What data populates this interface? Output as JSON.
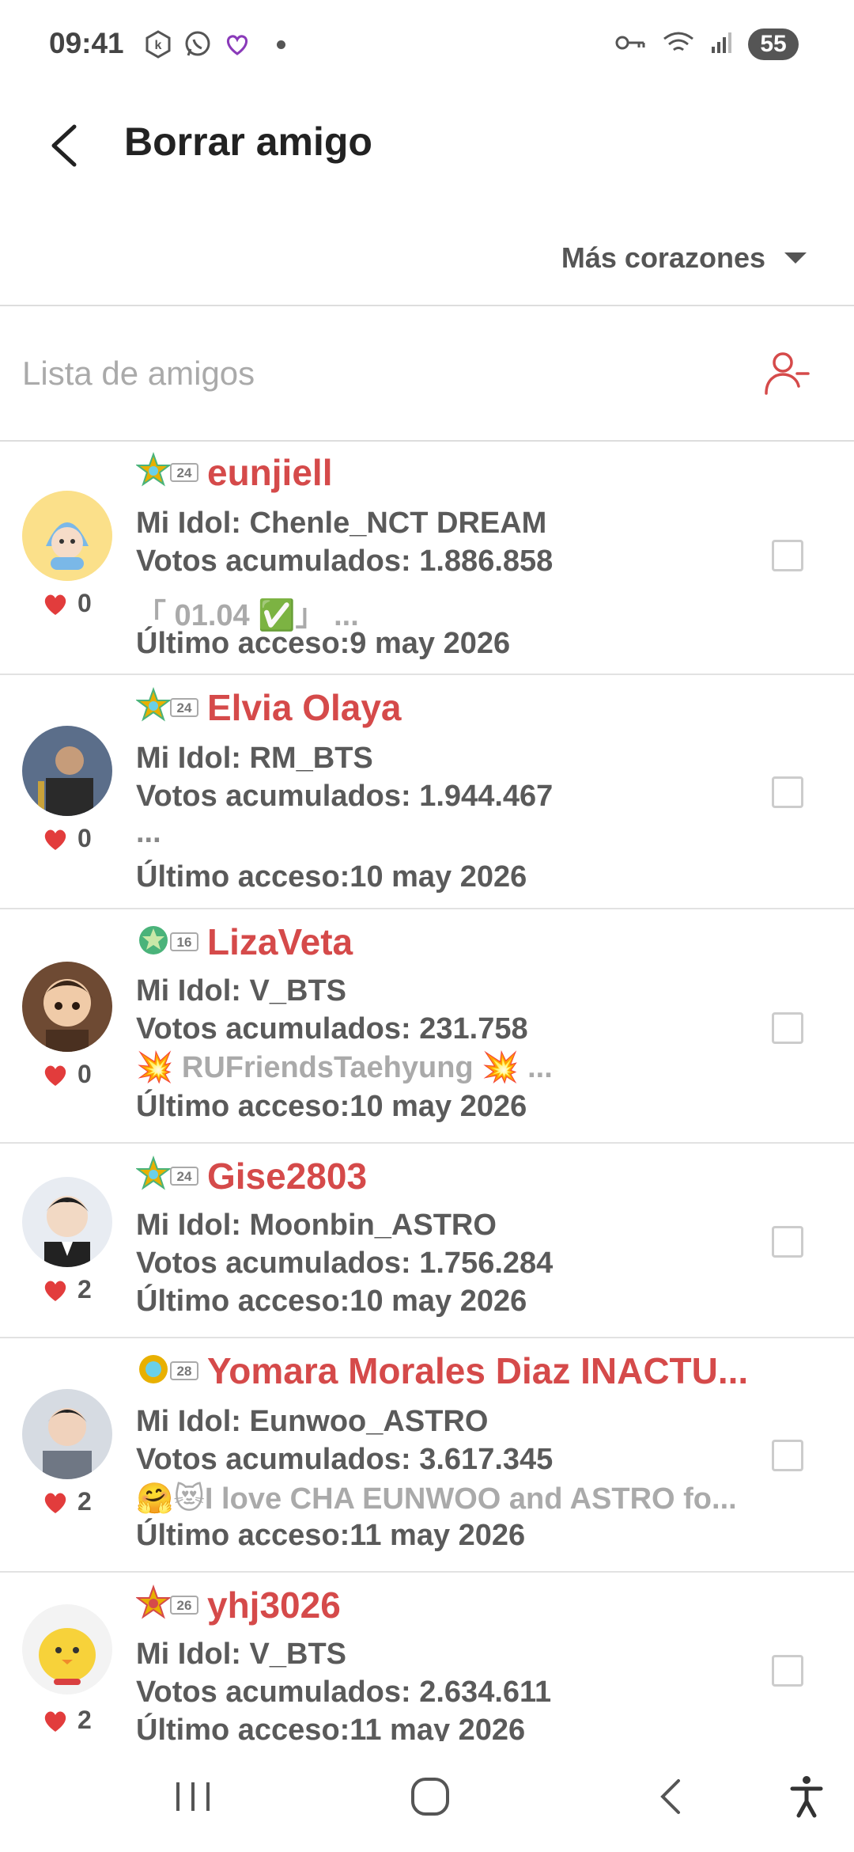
{
  "status_bar": {
    "time": "09:41",
    "battery": "55"
  },
  "header": {
    "title": "Borrar amigo"
  },
  "sort": {
    "label": "Más corazones"
  },
  "list": {
    "label": "Lista de amigos"
  },
  "colors": {
    "accent": "#d54a4a",
    "heart": "#e23c3c",
    "gold_badge": "#e8b000",
    "green_badge": "#4ab37a"
  },
  "friends": [
    {
      "level": "24",
      "name": "eunjiell",
      "idol": "Mi Idol: Chenle_NCT DREAM",
      "votes": "Votos acumulados: 1.886.858",
      "note": "「 01.04 ✅」 ...",
      "last": "Último acceso:9 may 2026",
      "hearts": "0"
    },
    {
      "level": "24",
      "name": "Elvia Olaya",
      "idol": "Mi Idol: RM_BTS",
      "votes": "Votos acumulados: 1.944.467",
      "note": "...",
      "last": "Último acceso:10 may 2026",
      "hearts": "0"
    },
    {
      "level": "16",
      "name": "LizaVeta",
      "idol": "Mi Idol: V_BTS",
      "votes": "Votos acumulados: 231.758",
      "note": "💥 RUFriendsTaehyung 💥 ...",
      "last": "Último acceso:10 may 2026",
      "hearts": "0"
    },
    {
      "level": "24",
      "name": "Gise2803",
      "idol": "Mi Idol: Moonbin_ASTRO",
      "votes": "Votos acumulados: 1.756.284",
      "note": "",
      "last": "Último acceso:10 may 2026",
      "hearts": "2"
    },
    {
      "level": "28",
      "name": "Yomara Morales Diaz INACTU...",
      "idol": "Mi Idol: Eunwoo_ASTRO",
      "votes": "Votos acumulados: 3.617.345",
      "note": "🤗😻I love CHA EUNWOO and ASTRO fo...",
      "last": "Último acceso:11 may 2026",
      "hearts": "2"
    },
    {
      "level": "26",
      "name": "yhj3026",
      "idol": "Mi Idol: V_BTS",
      "votes": "Votos acumulados: 2.634.611",
      "note": "",
      "last": "Último acceso:11 may 2026",
      "hearts": "2"
    }
  ]
}
